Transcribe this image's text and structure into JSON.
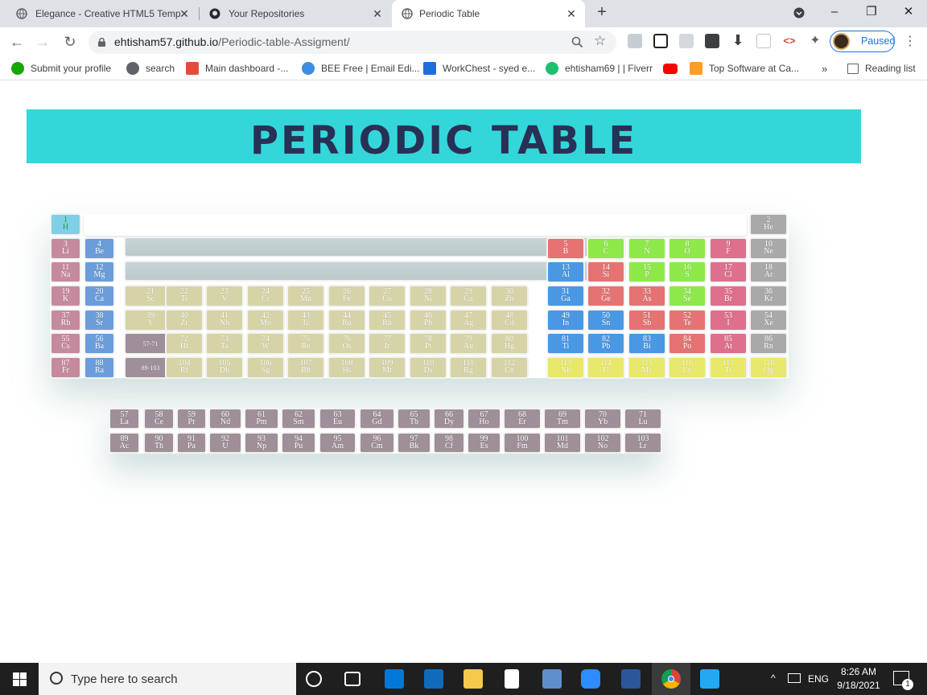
{
  "browser": {
    "tabs": [
      {
        "title": "Elegance - Creative HTML5 Temp",
        "icon": "globe-icon"
      },
      {
        "title": "Your Repositories",
        "icon": "github-icon"
      },
      {
        "title": "Periodic Table",
        "icon": "globe-icon"
      }
    ],
    "active_tab": 2,
    "url_host": "ehtisham57.github.io",
    "url_path": "/Periodic-table-Assigment/",
    "profile_label": "Paused",
    "bookmarks": [
      {
        "label": "Submit your profile",
        "icon": "upwork-icon",
        "color": "#14a800"
      },
      {
        "label": "search",
        "icon": "globe-icon",
        "color": "#5f6368"
      },
      {
        "label": "Main dashboard -...",
        "icon": "dashboard-icon",
        "color": "#e24c3d"
      },
      {
        "label": "BEE Free | Email Edi...",
        "icon": "bee-icon",
        "color": "#3b8ee0"
      },
      {
        "label": "WorkChest - syed e...",
        "icon": "workchest-icon",
        "color": "#1d6fe0"
      },
      {
        "label": "ehtisham69 | | Fiverr",
        "icon": "fiverr-icon",
        "color": "#1dbf73"
      },
      {
        "label": "",
        "icon": "youtube-icon",
        "color": "#ff0000"
      },
      {
        "label": "Top Software at Ca...",
        "icon": "capterra-icon",
        "color": "#ff9d28"
      }
    ],
    "reading_list": "Reading list",
    "overflow": "»"
  },
  "page": {
    "title": "PERIODIC TABLE",
    "colors": {
      "banner": "#33d7da",
      "title": "#283155",
      "hydrogen": "#7fd0e6",
      "alkali": "#c68a9f",
      "alkaline_earth": "#6b9ddb",
      "transition": "#d6d4a6",
      "metal": "#4a97e3",
      "metalloid": "#e57373",
      "nonmetal": "#8fe84a",
      "halogen": "#de6f8d",
      "noble": "#a9a9a9",
      "unknown": "#e8e86a",
      "lanthanide": "#9e8f99"
    },
    "main_elements": [
      {
        "n": "1",
        "s": "H",
        "c": "hydrogen",
        "col": 0,
        "row": 0
      },
      {
        "n": "2",
        "s": "He",
        "c": "noble",
        "col": 17,
        "row": 0
      },
      {
        "n": "3",
        "s": "Li",
        "c": "alkali",
        "col": 0,
        "row": 1
      },
      {
        "n": "4",
        "s": "Be",
        "c": "alkaline_earth",
        "col": 1,
        "row": 1
      },
      {
        "n": "5",
        "s": "B",
        "c": "metalloid",
        "col": 12,
        "row": 1
      },
      {
        "n": "6",
        "s": "C",
        "c": "nonmetal",
        "col": 13,
        "row": 1
      },
      {
        "n": "7",
        "s": "N",
        "c": "nonmetal",
        "col": 14,
        "row": 1
      },
      {
        "n": "8",
        "s": "O",
        "c": "nonmetal",
        "col": 15,
        "row": 1
      },
      {
        "n": "9",
        "s": "F",
        "c": "halogen",
        "col": 16,
        "row": 1
      },
      {
        "n": "10",
        "s": "Ne",
        "c": "noble",
        "col": 17,
        "row": 1
      },
      {
        "n": "11",
        "s": "Na",
        "c": "alkali",
        "col": 0,
        "row": 2
      },
      {
        "n": "12",
        "s": "Mg",
        "c": "alkaline_earth",
        "col": 1,
        "row": 2
      },
      {
        "n": "13",
        "s": "Al",
        "c": "metal",
        "col": 12,
        "row": 2
      },
      {
        "n": "14",
        "s": "Si",
        "c": "metalloid",
        "col": 13,
        "row": 2
      },
      {
        "n": "15",
        "s": "P",
        "c": "nonmetal",
        "col": 14,
        "row": 2
      },
      {
        "n": "16",
        "s": "S",
        "c": "nonmetal",
        "col": 15,
        "row": 2
      },
      {
        "n": "17",
        "s": "Cl",
        "c": "halogen",
        "col": 16,
        "row": 2
      },
      {
        "n": "18",
        "s": "Ar",
        "c": "noble",
        "col": 17,
        "row": 2
      },
      {
        "n": "19",
        "s": "K",
        "c": "alkali",
        "col": 0,
        "row": 3
      },
      {
        "n": "20",
        "s": "Ca",
        "c": "alkaline_earth",
        "col": 1,
        "row": 3
      },
      {
        "n": "21",
        "s": "Sc",
        "c": "transition",
        "col": 2,
        "row": 3
      },
      {
        "n": "22",
        "s": "Ti",
        "c": "transition",
        "col": 3,
        "row": 3
      },
      {
        "n": "23",
        "s": "V",
        "c": "transition",
        "col": 4,
        "row": 3
      },
      {
        "n": "24",
        "s": "Cr",
        "c": "transition",
        "col": 5,
        "row": 3
      },
      {
        "n": "25",
        "s": "Mn",
        "c": "transition",
        "col": 6,
        "row": 3
      },
      {
        "n": "26",
        "s": "Fe",
        "c": "transition",
        "col": 7,
        "row": 3
      },
      {
        "n": "27",
        "s": "Co",
        "c": "transition",
        "col": 8,
        "row": 3
      },
      {
        "n": "28",
        "s": "Ni",
        "c": "transition",
        "col": 9,
        "row": 3
      },
      {
        "n": "29",
        "s": "Cu",
        "c": "transition",
        "col": 10,
        "row": 3
      },
      {
        "n": "30",
        "s": "Zn",
        "c": "transition",
        "col": 11,
        "row": 3
      },
      {
        "n": "31",
        "s": "Ga",
        "c": "metal",
        "col": 12,
        "row": 3
      },
      {
        "n": "32",
        "s": "Ge",
        "c": "metalloid",
        "col": 13,
        "row": 3
      },
      {
        "n": "33",
        "s": "As",
        "c": "metalloid",
        "col": 14,
        "row": 3
      },
      {
        "n": "34",
        "s": "Se",
        "c": "nonmetal",
        "col": 15,
        "row": 3
      },
      {
        "n": "35",
        "s": "Br",
        "c": "halogen",
        "col": 16,
        "row": 3
      },
      {
        "n": "36",
        "s": "Kr",
        "c": "noble",
        "col": 17,
        "row": 3
      },
      {
        "n": "37",
        "s": "Rb",
        "c": "alkali",
        "col": 0,
        "row": 4
      },
      {
        "n": "38",
        "s": "Sr",
        "c": "alkaline_earth",
        "col": 1,
        "row": 4
      },
      {
        "n": "39",
        "s": "Y",
        "c": "transition",
        "col": 2,
        "row": 4
      },
      {
        "n": "40",
        "s": "Zr",
        "c": "transition",
        "col": 3,
        "row": 4
      },
      {
        "n": "41",
        "s": "Nb",
        "c": "transition",
        "col": 4,
        "row": 4
      },
      {
        "n": "42",
        "s": "Mo",
        "c": "transition",
        "col": 5,
        "row": 4
      },
      {
        "n": "43",
        "s": "Tc",
        "c": "transition",
        "col": 6,
        "row": 4
      },
      {
        "n": "44",
        "s": "Ru",
        "c": "transition",
        "col": 7,
        "row": 4
      },
      {
        "n": "45",
        "s": "Rh",
        "c": "transition",
        "col": 8,
        "row": 4
      },
      {
        "n": "46",
        "s": "Pb",
        "c": "transition",
        "col": 9,
        "row": 4
      },
      {
        "n": "47",
        "s": "Ag",
        "c": "transition",
        "col": 10,
        "row": 4
      },
      {
        "n": "48",
        "s": "Cd",
        "c": "transition",
        "col": 11,
        "row": 4
      },
      {
        "n": "49",
        "s": "In",
        "c": "metal",
        "col": 12,
        "row": 4
      },
      {
        "n": "50",
        "s": "Sn",
        "c": "metal",
        "col": 13,
        "row": 4
      },
      {
        "n": "51",
        "s": "Sb",
        "c": "metalloid",
        "col": 14,
        "row": 4
      },
      {
        "n": "52",
        "s": "Te",
        "c": "metalloid",
        "col": 15,
        "row": 4
      },
      {
        "n": "53",
        "s": "I",
        "c": "halogen",
        "col": 16,
        "row": 4
      },
      {
        "n": "54",
        "s": "Xe",
        "c": "noble",
        "col": 17,
        "row": 4
      },
      {
        "n": "55",
        "s": "Cs",
        "c": "alkali",
        "col": 0,
        "row": 5
      },
      {
        "n": "56",
        "s": "Ba",
        "c": "alkaline_earth",
        "col": 1,
        "row": 5
      },
      {
        "n": "57-71",
        "s": "",
        "c": "lanthanide",
        "col": 2,
        "row": 5
      },
      {
        "n": "72",
        "s": "Hf",
        "c": "transition",
        "col": 3,
        "row": 5
      },
      {
        "n": "73",
        "s": "Ta",
        "c": "transition",
        "col": 4,
        "row": 5
      },
      {
        "n": "74",
        "s": "W",
        "c": "transition",
        "col": 5,
        "row": 5
      },
      {
        "n": "75",
        "s": "Re",
        "c": "transition",
        "col": 6,
        "row": 5
      },
      {
        "n": "76",
        "s": "Os",
        "c": "transition",
        "col": 7,
        "row": 5
      },
      {
        "n": "77",
        "s": "Ir",
        "c": "transition",
        "col": 8,
        "row": 5
      },
      {
        "n": "78",
        "s": "Pt",
        "c": "transition",
        "col": 9,
        "row": 5
      },
      {
        "n": "79",
        "s": "Au",
        "c": "transition",
        "col": 10,
        "row": 5
      },
      {
        "n": "80",
        "s": "Hg",
        "c": "transition",
        "col": 11,
        "row": 5
      },
      {
        "n": "81",
        "s": "Ti",
        "c": "metal",
        "col": 12,
        "row": 5
      },
      {
        "n": "82",
        "s": "Pb",
        "c": "metal",
        "col": 13,
        "row": 5
      },
      {
        "n": "83",
        "s": "Bi",
        "c": "metal",
        "col": 14,
        "row": 5
      },
      {
        "n": "84",
        "s": "Po",
        "c": "metalloid",
        "col": 15,
        "row": 5
      },
      {
        "n": "85",
        "s": "At",
        "c": "halogen",
        "col": 16,
        "row": 5
      },
      {
        "n": "86",
        "s": "Rn",
        "c": "noble",
        "col": 17,
        "row": 5
      },
      {
        "n": "87",
        "s": "Fr",
        "c": "alkali",
        "col": 0,
        "row": 6
      },
      {
        "n": "88",
        "s": "Ra",
        "c": "alkaline_earth",
        "col": 1,
        "row": 6
      },
      {
        "n": "89-103",
        "s": "",
        "c": "lanthanide",
        "col": 2,
        "row": 6
      },
      {
        "n": "104",
        "s": "Rf",
        "c": "transition",
        "col": 3,
        "row": 6
      },
      {
        "n": "105",
        "s": "Db",
        "c": "transition",
        "col": 4,
        "row": 6
      },
      {
        "n": "106",
        "s": "Sg",
        "c": "transition",
        "col": 5,
        "row": 6
      },
      {
        "n": "107",
        "s": "Bh",
        "c": "transition",
        "col": 6,
        "row": 6
      },
      {
        "n": "108",
        "s": "Hs",
        "c": "transition",
        "col": 7,
        "row": 6
      },
      {
        "n": "109",
        "s": "Mt",
        "c": "transition",
        "col": 8,
        "row": 6
      },
      {
        "n": "110",
        "s": "Ds",
        "c": "transition",
        "col": 9,
        "row": 6
      },
      {
        "n": "111",
        "s": "Rg",
        "c": "transition",
        "col": 10,
        "row": 6
      },
      {
        "n": "112",
        "s": "Cn",
        "c": "transition",
        "col": 11,
        "row": 6
      },
      {
        "n": "113",
        "s": "Nh",
        "c": "unknown",
        "col": 12,
        "row": 6
      },
      {
        "n": "114",
        "s": "Fl",
        "c": "unknown",
        "col": 13,
        "row": 6
      },
      {
        "n": "115",
        "s": "Mc",
        "c": "unknown",
        "col": 14,
        "row": 6
      },
      {
        "n": "116",
        "s": "Lv",
        "c": "unknown",
        "col": 15,
        "row": 6
      },
      {
        "n": "117",
        "s": "Ts",
        "c": "unknown",
        "col": 16,
        "row": 6
      },
      {
        "n": "118",
        "s": "Og",
        "c": "unknown",
        "col": 17,
        "row": 6
      }
    ],
    "lanthanides": [
      {
        "n": "57",
        "s": "La"
      },
      {
        "n": "58",
        "s": "Ce"
      },
      {
        "n": "59",
        "s": "Pr"
      },
      {
        "n": "60",
        "s": "Nd"
      },
      {
        "n": "61",
        "s": "Pm"
      },
      {
        "n": "62",
        "s": "Sm"
      },
      {
        "n": "63",
        "s": "Eu"
      },
      {
        "n": "64",
        "s": "Gd"
      },
      {
        "n": "65",
        "s": "Tb"
      },
      {
        "n": "66",
        "s": "Dy"
      },
      {
        "n": "67",
        "s": "Ho"
      },
      {
        "n": "68",
        "s": "Er"
      },
      {
        "n": "69",
        "s": "Tm"
      },
      {
        "n": "70",
        "s": "Yb"
      },
      {
        "n": "71",
        "s": "Lu"
      }
    ],
    "actinides": [
      {
        "n": "89",
        "s": "Ac"
      },
      {
        "n": "90",
        "s": "Th"
      },
      {
        "n": "91",
        "s": "Pa"
      },
      {
        "n": "92",
        "s": "U"
      },
      {
        "n": "93",
        "s": "Np"
      },
      {
        "n": "94",
        "s": "Pu"
      },
      {
        "n": "95",
        "s": "Am"
      },
      {
        "n": "96",
        "s": "Cm"
      },
      {
        "n": "97",
        "s": "Bk"
      },
      {
        "n": "98",
        "s": "Cf"
      },
      {
        "n": "99",
        "s": "Es"
      },
      {
        "n": "100",
        "s": "Fm"
      },
      {
        "n": "101",
        "s": "Md"
      },
      {
        "n": "102",
        "s": "No"
      },
      {
        "n": "103",
        "s": "Lr"
      }
    ]
  },
  "taskbar": {
    "search_placeholder": "Type here to search",
    "language": "ENG",
    "time": "8:26 AM",
    "date": "9/18/2021",
    "notification_count": "1"
  }
}
